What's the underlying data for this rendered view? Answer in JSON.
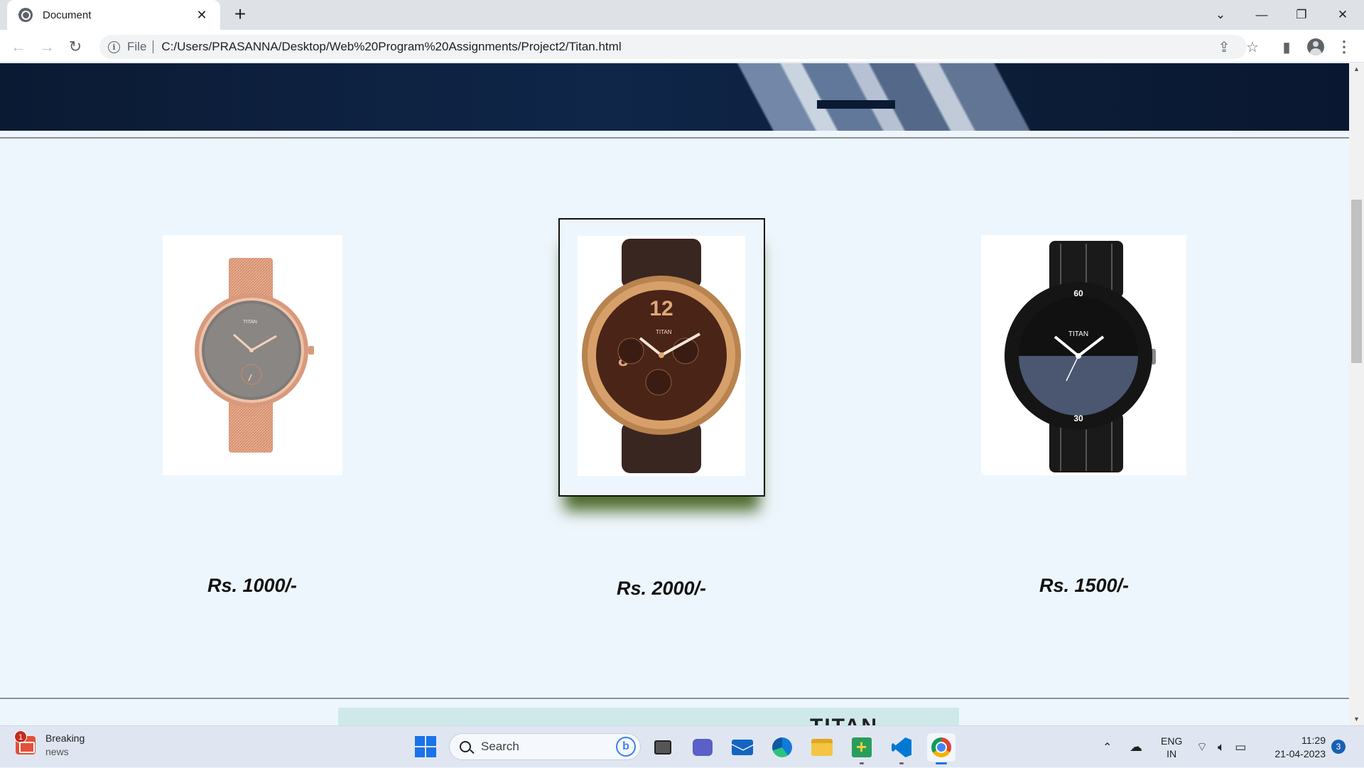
{
  "browser": {
    "tab_title": "Document",
    "new_tab_symbol": "+",
    "url_scheme": "File",
    "url": "C:/Users/PRASANNA/Desktop/Web%20Program%20Assignments/Project2/Titan.html"
  },
  "page": {
    "products": [
      {
        "name": "rose-gold-mesh-watch",
        "price": "Rs. 1000/-",
        "featured": false
      },
      {
        "name": "brown-chronograph-watch",
        "price": "Rs. 2000/-",
        "featured": true
      },
      {
        "name": "black-steel-watch",
        "price": "Rs. 1500/-",
        "featured": false
      }
    ],
    "footer_teaser_text": "TITAN"
  },
  "taskbar": {
    "news_title": "Breaking",
    "news_sub": "news",
    "news_badge": "1",
    "search_placeholder": "Search",
    "lang_top": "ENG",
    "lang_bottom": "IN",
    "time": "11:29",
    "date": "21-04-2023",
    "notifications": "3"
  },
  "icons": {
    "favicon": "globe-icon",
    "close": "close-icon",
    "back": "back-arrow-icon",
    "forward": "forward-arrow-icon",
    "reload": "reload-icon",
    "info": "info-icon",
    "share": "share-icon",
    "bookmark": "star-icon",
    "side_panel": "side-panel-icon",
    "profile": "profile-icon",
    "menu": "kebab-menu-icon"
  },
  "colors": {
    "page_background": "#eef6fd",
    "featured_shadow": "#4f6d2f",
    "banner": "#0f2649",
    "accent": "#1a73e8"
  }
}
